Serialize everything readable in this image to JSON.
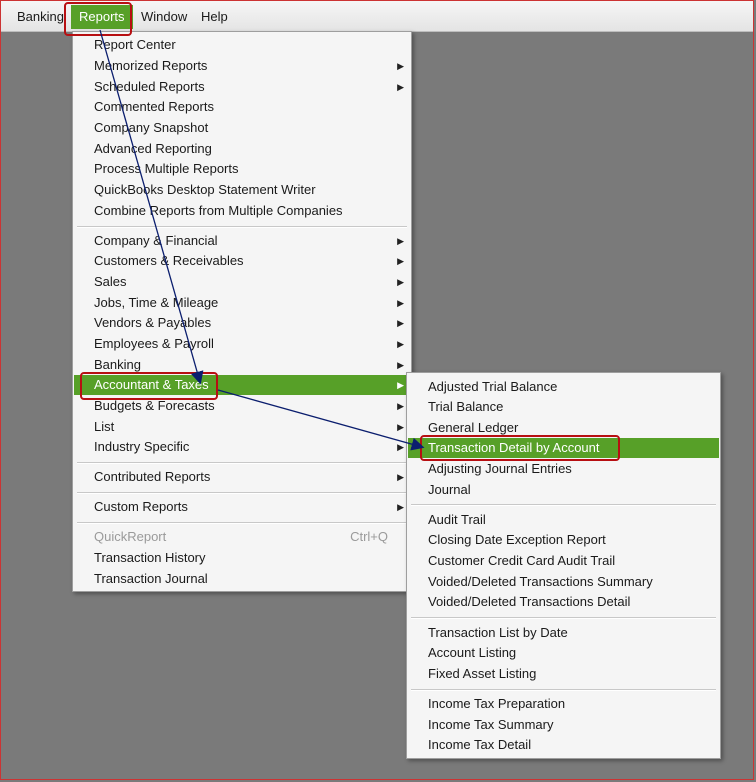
{
  "menubar": {
    "items": [
      "Banking",
      "Reports",
      "Window",
      "Help"
    ],
    "active": "Reports"
  },
  "reports_menu": {
    "group1": [
      "Report Center",
      "Memorized Reports",
      "Scheduled Reports",
      "Commented Reports",
      "Company Snapshot",
      "Advanced Reporting",
      "Process Multiple Reports",
      "QuickBooks Desktop Statement Writer",
      "Combine Reports from Multiple Companies"
    ],
    "group2": [
      "Company & Financial",
      "Customers & Receivables",
      "Sales",
      "Jobs, Time & Mileage",
      "Vendors & Payables",
      "Employees & Payroll",
      "Banking",
      "Accountant & Taxes",
      "Budgets & Forecasts",
      "List",
      "Industry Specific"
    ],
    "contributed": "Contributed Reports",
    "custom": "Custom Reports",
    "quickreport": {
      "label": "QuickReport",
      "shortcut": "Ctrl+Q"
    },
    "transaction_history": "Transaction History",
    "transaction_journal": "Transaction Journal",
    "selected": "Accountant & Taxes"
  },
  "accountant_submenu": {
    "group1": [
      "Adjusted Trial Balance",
      "Trial Balance",
      "General Ledger",
      "Transaction Detail by Account",
      "Adjusting Journal Entries",
      "Journal"
    ],
    "group2": [
      "Audit Trail",
      "Closing Date Exception Report",
      "Customer Credit Card Audit Trail",
      "Voided/Deleted Transactions Summary",
      "Voided/Deleted Transactions Detail"
    ],
    "group3": [
      "Transaction List by Date",
      "Account Listing",
      "Fixed Asset Listing"
    ],
    "group4": [
      "Income Tax Preparation",
      "Income Tax Summary",
      "Income Tax Detail"
    ],
    "selected": "Transaction Detail by Account"
  },
  "colors": {
    "highlight": "#57a028",
    "annotation": "#b70f12",
    "arrow": "#0b1e6e",
    "background": "#7a7a7a"
  }
}
